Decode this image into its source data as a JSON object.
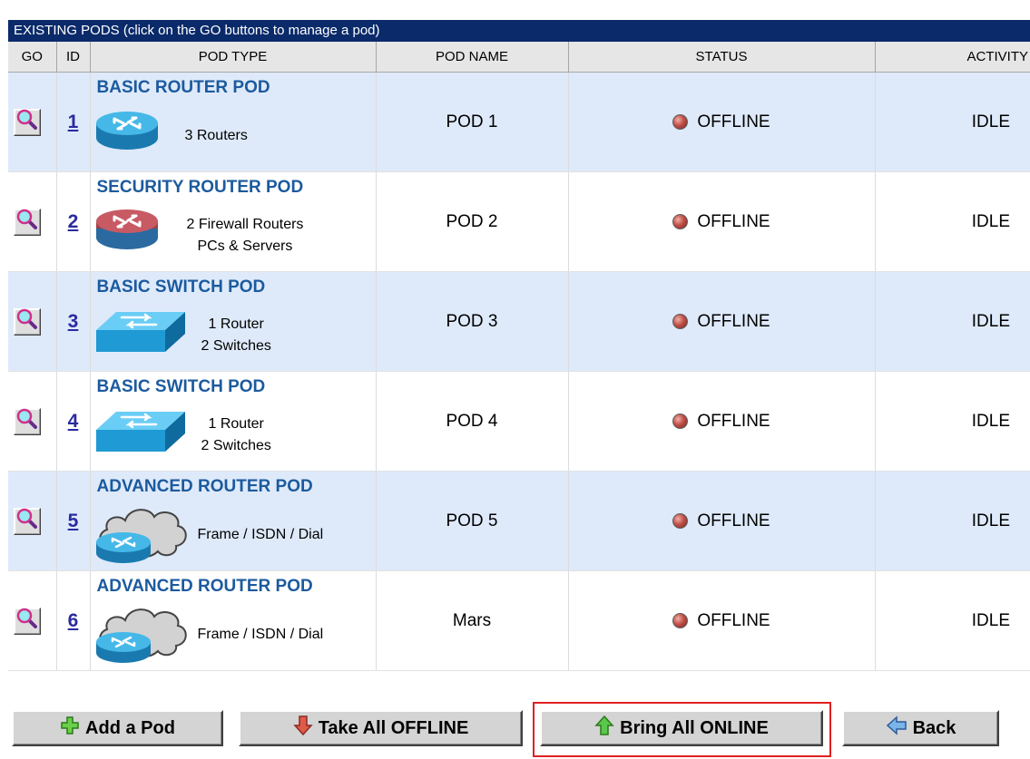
{
  "header": {
    "title": "EXISTING PODS   (click on the GO buttons to manage a pod)",
    "columns": [
      "GO",
      "ID",
      "POD TYPE",
      "POD NAME",
      "STATUS",
      "ACTIVITY"
    ]
  },
  "pods": [
    {
      "id": "1",
      "type": "BASIC ROUTER POD",
      "icon": "router-icon",
      "icon_color": "#2aa4d8",
      "desc1": "3 Routers",
      "desc2": "",
      "name": "POD 1",
      "status": "OFFLINE",
      "activity": "IDLE"
    },
    {
      "id": "2",
      "type": "SECURITY ROUTER POD",
      "icon": "firewall-router-icon",
      "icon_color": "#c0505a",
      "desc1": "2 Firewall Routers",
      "desc2": "PCs & Servers",
      "name": "POD 2",
      "status": "OFFLINE",
      "activity": "IDLE"
    },
    {
      "id": "3",
      "type": "BASIC SWITCH POD",
      "icon": "switch-icon",
      "icon_color": "#2aa4d8",
      "desc1": "1 Router",
      "desc2": "2 Switches",
      "name": "POD 3",
      "status": "OFFLINE",
      "activity": "IDLE"
    },
    {
      "id": "4",
      "type": "BASIC SWITCH POD",
      "icon": "switch-icon",
      "icon_color": "#2aa4d8",
      "desc1": "1 Router",
      "desc2": "2 Switches",
      "name": "POD 4",
      "status": "OFFLINE",
      "activity": "IDLE"
    },
    {
      "id": "5",
      "type": "ADVANCED ROUTER POD",
      "icon": "cloud-router-icon",
      "icon_color": "#2aa4d8",
      "desc1": "Frame / ISDN / Dial",
      "desc2": "",
      "name": "POD 5",
      "status": "OFFLINE",
      "activity": "IDLE"
    },
    {
      "id": "6",
      "type": "ADVANCED ROUTER POD",
      "icon": "cloud-router-icon",
      "icon_color": "#2aa4d8",
      "desc1": "Frame / ISDN / Dial",
      "desc2": "",
      "name": "Mars",
      "status": "OFFLINE",
      "activity": "IDLE"
    }
  ],
  "buttons": {
    "add": {
      "label": "Add a Pod",
      "icon": "plus-icon",
      "color": "#6ad04a"
    },
    "offline": {
      "label": "Take All OFFLINE",
      "icon": "arrow-down-icon",
      "color": "#e05a4a"
    },
    "online": {
      "label": "Bring All ONLINE",
      "icon": "arrow-up-icon",
      "color": "#5ac84a"
    },
    "back": {
      "label": "Back",
      "icon": "arrow-left-icon",
      "color": "#7ab4e8"
    }
  },
  "colors": {
    "title_bar": "#0a2a6a",
    "row_shade": "#deeafa",
    "pod_type_text": "#1c5a9e",
    "highlight": "#e02020"
  }
}
